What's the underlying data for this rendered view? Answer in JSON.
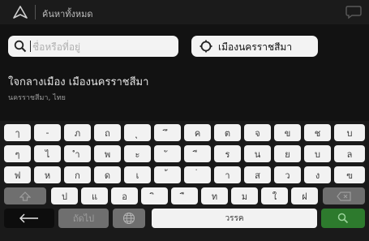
{
  "header": {
    "title": "ค้นหาทั้งหมด",
    "nav_icon": "navigation-arrow-icon",
    "chat_icon": "speech-bubble-icon"
  },
  "search": {
    "placeholder": "ชื่อหรือที่อยู่",
    "icon": "search-icon"
  },
  "city_button": {
    "label": "เมืองนครราชสีมา",
    "icon": "crosshair-icon"
  },
  "result": {
    "title": "ใจกลางเมือง เมืองนครราชสีมา",
    "subtitle": "นครราชสีมา, ไทย"
  },
  "keyboard": {
    "row1": [
      "ๅ",
      "-",
      "ภ",
      "ถ",
      "ุ",
      "ึ",
      "ค",
      "ต",
      "จ",
      "ข",
      "ช",
      "บ"
    ],
    "row2": [
      "ๆ",
      "ไ",
      "ำ",
      "พ",
      "ะ",
      "ั",
      "ี",
      "ร",
      "น",
      "ย",
      "บ",
      "ล"
    ],
    "row3": [
      "ฟ",
      "ห",
      "ก",
      "ด",
      "เ",
      "้",
      "่",
      "า",
      "ส",
      "ว",
      "ง",
      "ฃ"
    ],
    "row4": [
      "ป",
      "แ",
      "อ",
      "ิ",
      "ื",
      "ท",
      "ม",
      "ใ",
      "ฝ"
    ],
    "back_icon": "back-arrow-icon",
    "next_label": "ถัดไป",
    "globe_icon": "globe-icon",
    "space_label": "วรรค",
    "search_key_icon": "search-icon",
    "shift_icon": "shift-icon",
    "delete_icon": "backspace-icon"
  }
}
